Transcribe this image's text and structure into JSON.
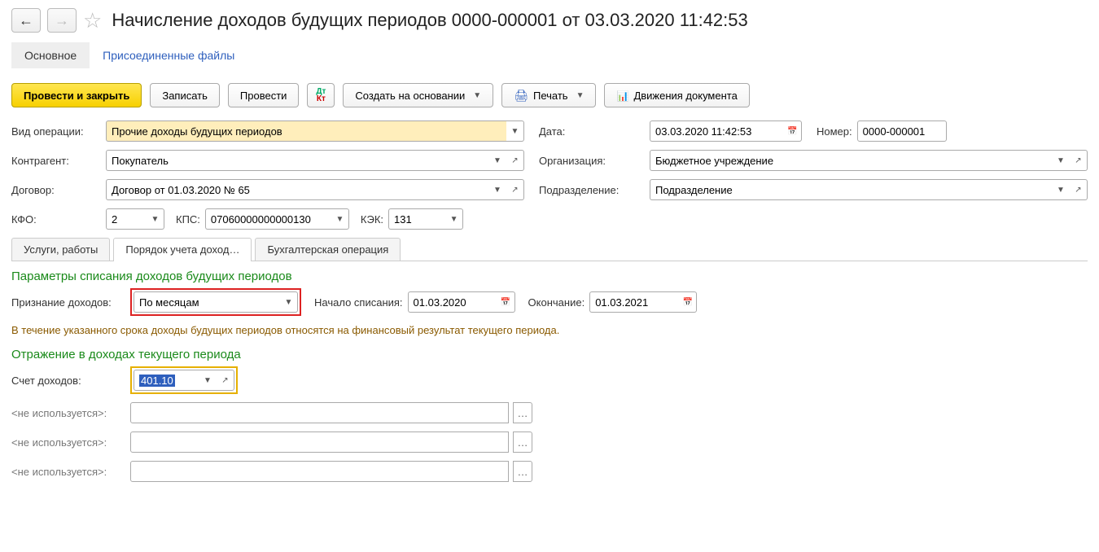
{
  "title": "Начисление доходов будущих периодов 0000-000001 от 03.03.2020 11:42:53",
  "topTabs": {
    "main": "Основное",
    "files": "Присоединенные файлы"
  },
  "toolbar": {
    "postAndClose": "Провести и закрыть",
    "save": "Записать",
    "post": "Провести",
    "createBasedOn": "Создать на основании",
    "print": "Печать",
    "movements": "Движения документа"
  },
  "labels": {
    "operationType": "Вид операции:",
    "date": "Дата:",
    "number": "Номер:",
    "counterparty": "Контрагент:",
    "organization": "Организация:",
    "contract": "Договор:",
    "department": "Подразделение:",
    "kfo": "КФО:",
    "kps": "КПС:",
    "kek": "КЭК:"
  },
  "values": {
    "operationType": "Прочие доходы будущих периодов",
    "date": "03.03.2020 11:42:53",
    "number": "0000-000001",
    "counterparty": "Покупатель",
    "organization": "Бюджетное учреждение",
    "contract": "Договор от 01.03.2020 № 65",
    "department": "Подразделение",
    "kfo": "2",
    "kps": "07060000000000130",
    "kek": "131"
  },
  "tabs2": {
    "services": "Услуги, работы",
    "order": "Порядок учета доход…",
    "accounting": "Бухгалтерская операция"
  },
  "section1": {
    "title": "Параметры списания доходов будущих периодов",
    "recognitionLabel": "Признание доходов:",
    "recognitionValue": "По месяцам",
    "startLabel": "Начало списания:",
    "startValue": "01.03.2020",
    "endLabel": "Окончание:",
    "endValue": "01.03.2021",
    "hint": "В течение указанного срока доходы будущих периодов относятся на финансовый результат текущего периода."
  },
  "section2": {
    "title": "Отражение в доходах текущего периода",
    "accountLabel": "Счет доходов:",
    "accountValue": "401.10",
    "unused": "<не используется>:"
  }
}
